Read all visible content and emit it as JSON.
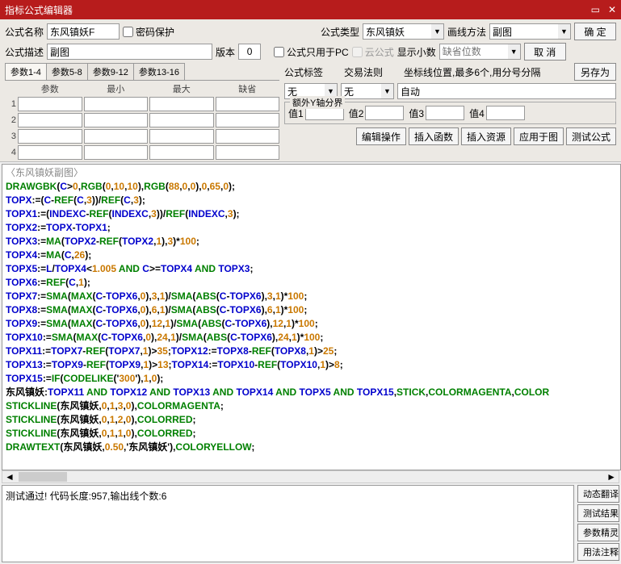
{
  "title": "指标公式编辑器",
  "labels": {
    "name": "公式名称",
    "pwd": "密码保护",
    "type": "公式类型",
    "linem": "画线方法",
    "ok": "确 定",
    "desc": "公式描述",
    "ver": "版本",
    "pconly": "公式只用于PC",
    "cloud": "云公式",
    "dec": "显示小数",
    "decpos": "缺省位数",
    "cancel": "取 消",
    "tag": "公式标签",
    "rule": "交易法则",
    "coord": "坐标线位置,最多6个,用分号分隔",
    "saveas": "另存为",
    "auto": "自动",
    "extray": "额外Y轴分界",
    "v1": "值1",
    "v2": "值2",
    "v3": "值3",
    "v4": "值4",
    "editop": "编辑操作",
    "insfn": "插入函数",
    "insres": "插入资源",
    "apply": "应用于图",
    "test": "测试公式",
    "dyntr": "动态翻译",
    "testres": "测试结果",
    "paramw": "参数精灵",
    "usage": "用法注释"
  },
  "values": {
    "name": "东风镇妖F",
    "desc": "副图",
    "ver": "0",
    "type": "东风镇妖",
    "linem": "副图",
    "tag": "无",
    "rule": "无"
  },
  "param_tabs": [
    "参数1-4",
    "参数5-8",
    "参数9-12",
    "参数13-16"
  ],
  "param_hdr": [
    "参数",
    "最小",
    "最大",
    "缺省"
  ],
  "status": "测试通过! 代码长度:957,输出线个数:6",
  "code": [
    [
      [
        "cmt",
        "〈东风镇妖副图〉"
      ]
    ],
    [
      [
        "kw",
        "DRAWGBK"
      ],
      [
        "txt",
        "("
      ],
      [
        "id",
        "C"
      ],
      [
        "txt",
        ">"
      ],
      [
        "num",
        "0"
      ],
      [
        "txt",
        ","
      ],
      [
        "kw",
        "RGB"
      ],
      [
        "txt",
        "("
      ],
      [
        "num",
        "0"
      ],
      [
        "txt",
        ","
      ],
      [
        "num",
        "10"
      ],
      [
        "txt",
        ","
      ],
      [
        "num",
        "10"
      ],
      [
        "txt",
        "),"
      ],
      [
        "kw",
        "RGB"
      ],
      [
        "txt",
        "("
      ],
      [
        "num",
        "88"
      ],
      [
        "txt",
        ","
      ],
      [
        "num",
        "0"
      ],
      [
        "txt",
        ","
      ],
      [
        "num",
        "0"
      ],
      [
        "txt",
        "),"
      ],
      [
        "num",
        "0"
      ],
      [
        "txt",
        ","
      ],
      [
        "num",
        "65"
      ],
      [
        "txt",
        ","
      ],
      [
        "num",
        "0"
      ],
      [
        "txt",
        ");"
      ]
    ],
    [
      [
        "id",
        "TOPX"
      ],
      [
        "txt",
        ":=("
      ],
      [
        "id",
        "C"
      ],
      [
        "txt",
        "-"
      ],
      [
        "kw",
        "REF"
      ],
      [
        "txt",
        "("
      ],
      [
        "id",
        "C"
      ],
      [
        "txt",
        ","
      ],
      [
        "num",
        "3"
      ],
      [
        "txt",
        "))/"
      ],
      [
        "kw",
        "REF"
      ],
      [
        "txt",
        "("
      ],
      [
        "id",
        "C"
      ],
      [
        "txt",
        ","
      ],
      [
        "num",
        "3"
      ],
      [
        "txt",
        ");"
      ]
    ],
    [
      [
        "id",
        "TOPX1"
      ],
      [
        "txt",
        ":=("
      ],
      [
        "id",
        "INDEXC"
      ],
      [
        "txt",
        "-"
      ],
      [
        "kw",
        "REF"
      ],
      [
        "txt",
        "("
      ],
      [
        "id",
        "INDEXC"
      ],
      [
        "txt",
        ","
      ],
      [
        "num",
        "3"
      ],
      [
        "txt",
        "))/"
      ],
      [
        "kw",
        "REF"
      ],
      [
        "txt",
        "("
      ],
      [
        "id",
        "INDEXC"
      ],
      [
        "txt",
        ","
      ],
      [
        "num",
        "3"
      ],
      [
        "txt",
        ");"
      ]
    ],
    [
      [
        "id",
        "TOPX2"
      ],
      [
        "txt",
        ":="
      ],
      [
        "id",
        "TOPX"
      ],
      [
        "txt",
        "-"
      ],
      [
        "id",
        "TOPX1"
      ],
      [
        "txt",
        ";"
      ]
    ],
    [
      [
        "id",
        "TOPX3"
      ],
      [
        "txt",
        ":="
      ],
      [
        "kw",
        "MA"
      ],
      [
        "txt",
        "("
      ],
      [
        "id",
        "TOPX2"
      ],
      [
        "txt",
        "-"
      ],
      [
        "kw",
        "REF"
      ],
      [
        "txt",
        "("
      ],
      [
        "id",
        "TOPX2"
      ],
      [
        "txt",
        ","
      ],
      [
        "num",
        "1"
      ],
      [
        "txt",
        "),"
      ],
      [
        "num",
        "3"
      ],
      [
        "txt",
        ")*"
      ],
      [
        "num",
        "100"
      ],
      [
        "txt",
        ";"
      ]
    ],
    [
      [
        "id",
        "TOPX4"
      ],
      [
        "txt",
        ":="
      ],
      [
        "kw",
        "MA"
      ],
      [
        "txt",
        "("
      ],
      [
        "id",
        "C"
      ],
      [
        "txt",
        ","
      ],
      [
        "num",
        "26"
      ],
      [
        "txt",
        ");"
      ]
    ],
    [
      [
        "id",
        "TOPX5"
      ],
      [
        "txt",
        ":="
      ],
      [
        "id",
        "L"
      ],
      [
        "txt",
        "/"
      ],
      [
        "id",
        "TOPX4"
      ],
      [
        "txt",
        "<"
      ],
      [
        "num",
        "1.005"
      ],
      [
        "txt",
        " "
      ],
      [
        "kw",
        "AND"
      ],
      [
        "txt",
        " "
      ],
      [
        "id",
        "C"
      ],
      [
        "txt",
        ">="
      ],
      [
        "id",
        "TOPX4"
      ],
      [
        "txt",
        " "
      ],
      [
        "kw",
        "AND"
      ],
      [
        "txt",
        " "
      ],
      [
        "id",
        "TOPX3"
      ],
      [
        "txt",
        ";"
      ]
    ],
    [
      [
        "id",
        "TOPX6"
      ],
      [
        "txt",
        ":="
      ],
      [
        "kw",
        "REF"
      ],
      [
        "txt",
        "("
      ],
      [
        "id",
        "C"
      ],
      [
        "txt",
        ","
      ],
      [
        "num",
        "1"
      ],
      [
        "txt",
        ");"
      ]
    ],
    [
      [
        "id",
        "TOPX7"
      ],
      [
        "txt",
        ":="
      ],
      [
        "kw",
        "SMA"
      ],
      [
        "txt",
        "("
      ],
      [
        "kw",
        "MAX"
      ],
      [
        "txt",
        "("
      ],
      [
        "id",
        "C"
      ],
      [
        "txt",
        "-"
      ],
      [
        "id",
        "TOPX6"
      ],
      [
        "txt",
        ","
      ],
      [
        "num",
        "0"
      ],
      [
        "txt",
        "),"
      ],
      [
        "num",
        "3"
      ],
      [
        "txt",
        ","
      ],
      [
        "num",
        "1"
      ],
      [
        "txt",
        ")/"
      ],
      [
        "kw",
        "SMA"
      ],
      [
        "txt",
        "("
      ],
      [
        "kw",
        "ABS"
      ],
      [
        "txt",
        "("
      ],
      [
        "id",
        "C"
      ],
      [
        "txt",
        "-"
      ],
      [
        "id",
        "TOPX6"
      ],
      [
        "txt",
        "),"
      ],
      [
        "num",
        "3"
      ],
      [
        "txt",
        ","
      ],
      [
        "num",
        "1"
      ],
      [
        "txt",
        ")*"
      ],
      [
        "num",
        "100"
      ],
      [
        "txt",
        ";"
      ]
    ],
    [
      [
        "id",
        "TOPX8"
      ],
      [
        "txt",
        ":="
      ],
      [
        "kw",
        "SMA"
      ],
      [
        "txt",
        "("
      ],
      [
        "kw",
        "MAX"
      ],
      [
        "txt",
        "("
      ],
      [
        "id",
        "C"
      ],
      [
        "txt",
        "-"
      ],
      [
        "id",
        "TOPX6"
      ],
      [
        "txt",
        ","
      ],
      [
        "num",
        "0"
      ],
      [
        "txt",
        "),"
      ],
      [
        "num",
        "6"
      ],
      [
        "txt",
        ","
      ],
      [
        "num",
        "1"
      ],
      [
        "txt",
        ")/"
      ],
      [
        "kw",
        "SMA"
      ],
      [
        "txt",
        "("
      ],
      [
        "kw",
        "ABS"
      ],
      [
        "txt",
        "("
      ],
      [
        "id",
        "C"
      ],
      [
        "txt",
        "-"
      ],
      [
        "id",
        "TOPX6"
      ],
      [
        "txt",
        "),"
      ],
      [
        "num",
        "6"
      ],
      [
        "txt",
        ","
      ],
      [
        "num",
        "1"
      ],
      [
        "txt",
        ")*"
      ],
      [
        "num",
        "100"
      ],
      [
        "txt",
        ";"
      ]
    ],
    [
      [
        "id",
        "TOPX9"
      ],
      [
        "txt",
        ":="
      ],
      [
        "kw",
        "SMA"
      ],
      [
        "txt",
        "("
      ],
      [
        "kw",
        "MAX"
      ],
      [
        "txt",
        "("
      ],
      [
        "id",
        "C"
      ],
      [
        "txt",
        "-"
      ],
      [
        "id",
        "TOPX6"
      ],
      [
        "txt",
        ","
      ],
      [
        "num",
        "0"
      ],
      [
        "txt",
        "),"
      ],
      [
        "num",
        "12"
      ],
      [
        "txt",
        ","
      ],
      [
        "num",
        "1"
      ],
      [
        "txt",
        ")/"
      ],
      [
        "kw",
        "SMA"
      ],
      [
        "txt",
        "("
      ],
      [
        "kw",
        "ABS"
      ],
      [
        "txt",
        "("
      ],
      [
        "id",
        "C"
      ],
      [
        "txt",
        "-"
      ],
      [
        "id",
        "TOPX6"
      ],
      [
        "txt",
        "),"
      ],
      [
        "num",
        "12"
      ],
      [
        "txt",
        ","
      ],
      [
        "num",
        "1"
      ],
      [
        "txt",
        ")*"
      ],
      [
        "num",
        "100"
      ],
      [
        "txt",
        ";"
      ]
    ],
    [
      [
        "id",
        "TOPX10"
      ],
      [
        "txt",
        ":="
      ],
      [
        "kw",
        "SMA"
      ],
      [
        "txt",
        "("
      ],
      [
        "kw",
        "MAX"
      ],
      [
        "txt",
        "("
      ],
      [
        "id",
        "C"
      ],
      [
        "txt",
        "-"
      ],
      [
        "id",
        "TOPX6"
      ],
      [
        "txt",
        ","
      ],
      [
        "num",
        "0"
      ],
      [
        "txt",
        "),"
      ],
      [
        "num",
        "24"
      ],
      [
        "txt",
        ","
      ],
      [
        "num",
        "1"
      ],
      [
        "txt",
        ")/"
      ],
      [
        "kw",
        "SMA"
      ],
      [
        "txt",
        "("
      ],
      [
        "kw",
        "ABS"
      ],
      [
        "txt",
        "("
      ],
      [
        "id",
        "C"
      ],
      [
        "txt",
        "-"
      ],
      [
        "id",
        "TOPX6"
      ],
      [
        "txt",
        "),"
      ],
      [
        "num",
        "24"
      ],
      [
        "txt",
        ","
      ],
      [
        "num",
        "1"
      ],
      [
        "txt",
        ")*"
      ],
      [
        "num",
        "100"
      ],
      [
        "txt",
        ";"
      ]
    ],
    [
      [
        "id",
        "TOPX11"
      ],
      [
        "txt",
        ":="
      ],
      [
        "id",
        "TOPX7"
      ],
      [
        "txt",
        "-"
      ],
      [
        "kw",
        "REF"
      ],
      [
        "txt",
        "("
      ],
      [
        "id",
        "TOPX7"
      ],
      [
        "txt",
        ","
      ],
      [
        "num",
        "1"
      ],
      [
        "txt",
        ")>"
      ],
      [
        "num",
        "35"
      ],
      [
        "txt",
        ";"
      ],
      [
        "id",
        "TOPX12"
      ],
      [
        "txt",
        ":="
      ],
      [
        "id",
        "TOPX8"
      ],
      [
        "txt",
        "-"
      ],
      [
        "kw",
        "REF"
      ],
      [
        "txt",
        "("
      ],
      [
        "id",
        "TOPX8"
      ],
      [
        "txt",
        ","
      ],
      [
        "num",
        "1"
      ],
      [
        "txt",
        ")>"
      ],
      [
        "num",
        "25"
      ],
      [
        "txt",
        ";"
      ]
    ],
    [
      [
        "id",
        "TOPX13"
      ],
      [
        "txt",
        ":="
      ],
      [
        "id",
        "TOPX9"
      ],
      [
        "txt",
        "-"
      ],
      [
        "kw",
        "REF"
      ],
      [
        "txt",
        "("
      ],
      [
        "id",
        "TOPX9"
      ],
      [
        "txt",
        ","
      ],
      [
        "num",
        "1"
      ],
      [
        "txt",
        ")>"
      ],
      [
        "num",
        "13"
      ],
      [
        "txt",
        ";"
      ],
      [
        "id",
        "TOPX14"
      ],
      [
        "txt",
        ":="
      ],
      [
        "id",
        "TOPX10"
      ],
      [
        "txt",
        "-"
      ],
      [
        "kw",
        "REF"
      ],
      [
        "txt",
        "("
      ],
      [
        "id",
        "TOPX10"
      ],
      [
        "txt",
        ","
      ],
      [
        "num",
        "1"
      ],
      [
        "txt",
        ")>"
      ],
      [
        "num",
        "8"
      ],
      [
        "txt",
        ";"
      ]
    ],
    [
      [
        "id",
        "TOPX15"
      ],
      [
        "txt",
        ":="
      ],
      [
        "kw",
        "IF"
      ],
      [
        "txt",
        "("
      ],
      [
        "kw",
        "CODELIKE"
      ],
      [
        "txt",
        "('"
      ],
      [
        "num",
        "300"
      ],
      [
        "txt",
        "'),"
      ],
      [
        "num",
        "1"
      ],
      [
        "txt",
        ","
      ],
      [
        "num",
        "0"
      ],
      [
        "txt",
        ");"
      ]
    ],
    [
      [
        "txt",
        "东风镇妖:"
      ],
      [
        "id",
        "TOPX11"
      ],
      [
        "txt",
        " "
      ],
      [
        "kw",
        "AND"
      ],
      [
        "txt",
        " "
      ],
      [
        "id",
        "TOPX12"
      ],
      [
        "txt",
        " "
      ],
      [
        "kw",
        "AND"
      ],
      [
        "txt",
        " "
      ],
      [
        "id",
        "TOPX13"
      ],
      [
        "txt",
        " "
      ],
      [
        "kw",
        "AND"
      ],
      [
        "txt",
        " "
      ],
      [
        "id",
        "TOPX14"
      ],
      [
        "txt",
        " "
      ],
      [
        "kw",
        "AND"
      ],
      [
        "txt",
        " "
      ],
      [
        "id",
        "TOPX5"
      ],
      [
        "txt",
        " "
      ],
      [
        "kw",
        "AND"
      ],
      [
        "txt",
        " "
      ],
      [
        "id",
        "TOPX15"
      ],
      [
        "txt",
        ","
      ],
      [
        "kw",
        "STICK"
      ],
      [
        "txt",
        ","
      ],
      [
        "kw",
        "COLORMAGENTA"
      ],
      [
        "txt",
        ","
      ],
      [
        "kw",
        "COLOR"
      ]
    ],
    [
      [
        "kw",
        "STICKLINE"
      ],
      [
        "txt",
        "(东风镇妖,"
      ],
      [
        "num",
        "0"
      ],
      [
        "txt",
        ","
      ],
      [
        "num",
        "1"
      ],
      [
        "txt",
        ","
      ],
      [
        "num",
        "3"
      ],
      [
        "txt",
        ","
      ],
      [
        "num",
        "0"
      ],
      [
        "txt",
        "),"
      ],
      [
        "kw",
        "COLORMAGENTA"
      ],
      [
        "txt",
        ";"
      ]
    ],
    [
      [
        "kw",
        "STICKLINE"
      ],
      [
        "txt",
        "(东风镇妖,"
      ],
      [
        "num",
        "0"
      ],
      [
        "txt",
        ","
      ],
      [
        "num",
        "1"
      ],
      [
        "txt",
        ","
      ],
      [
        "num",
        "2"
      ],
      [
        "txt",
        ","
      ],
      [
        "num",
        "0"
      ],
      [
        "txt",
        "),"
      ],
      [
        "kw",
        "COLORRED"
      ],
      [
        "txt",
        ";"
      ]
    ],
    [
      [
        "kw",
        "STICKLINE"
      ],
      [
        "txt",
        "(东风镇妖,"
      ],
      [
        "num",
        "0"
      ],
      [
        "txt",
        ","
      ],
      [
        "num",
        "1"
      ],
      [
        "txt",
        ","
      ],
      [
        "num",
        "1"
      ],
      [
        "txt",
        ","
      ],
      [
        "num",
        "0"
      ],
      [
        "txt",
        "),"
      ],
      [
        "kw",
        "COLORRED"
      ],
      [
        "txt",
        ";"
      ]
    ],
    [
      [
        "kw",
        "DRAWTEXT"
      ],
      [
        "txt",
        "(东风镇妖,"
      ],
      [
        "num",
        "0.50"
      ],
      [
        "txt",
        ",'东风镇妖'),"
      ],
      [
        "kw",
        "COLORYELLOW"
      ],
      [
        "txt",
        ";"
      ]
    ]
  ]
}
